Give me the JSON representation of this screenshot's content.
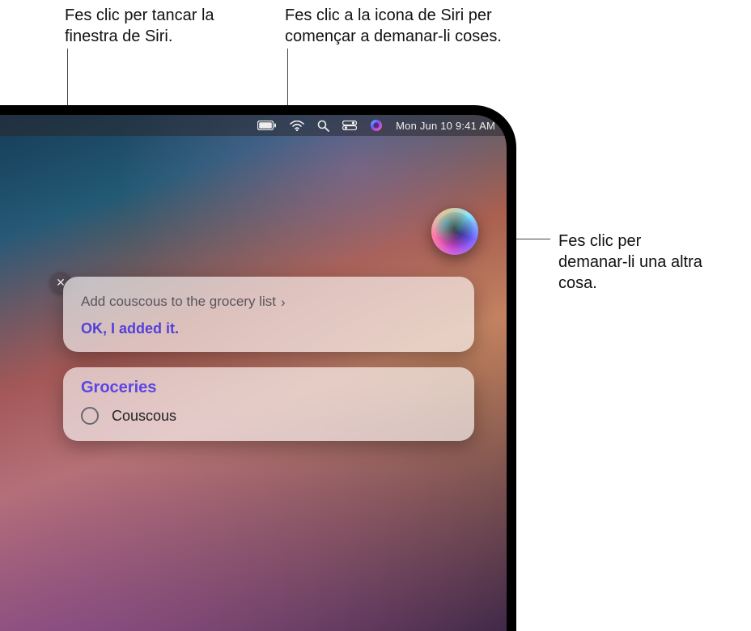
{
  "callouts": {
    "close": "Fes clic per tancar la finestra de Siri.",
    "siri_start": "Fes clic a la icona de Siri per començar a demanar-li coses.",
    "ask_another": "Fes clic per demanar-li una altra cosa."
  },
  "menubar": {
    "datetime": "Mon Jun 10  9:41 AM",
    "icons": {
      "battery": "battery-icon",
      "wifi": "wifi-icon",
      "search": "search-icon",
      "control_center": "control-center-icon",
      "siri": "siri-icon"
    }
  },
  "siri": {
    "close_label": "✕",
    "request_text": "Add couscous to the grocery list",
    "response_text": "OK, I added it.",
    "chevron": "›"
  },
  "reminders": {
    "list_title": "Groceries",
    "items": [
      {
        "text": "Couscous",
        "completed": false
      }
    ]
  }
}
